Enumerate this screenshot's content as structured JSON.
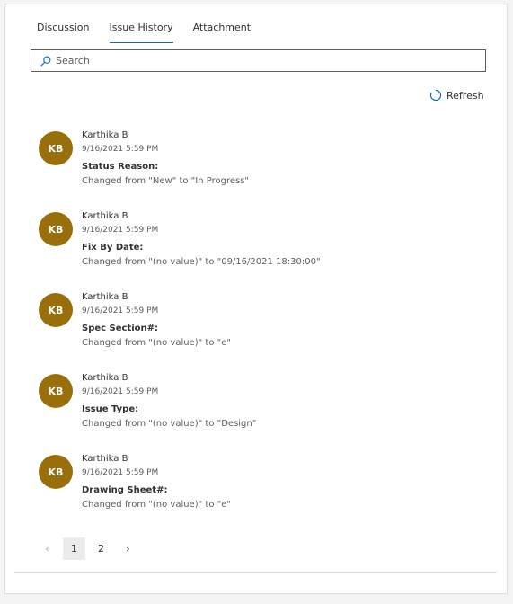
{
  "tabs": [
    {
      "label": "Discussion",
      "active": false
    },
    {
      "label": "Issue History",
      "active": true
    },
    {
      "label": "Attachment",
      "active": false
    }
  ],
  "search": {
    "placeholder": "Search",
    "icon": "search-icon"
  },
  "refresh": {
    "label": "Refresh",
    "icon": "refresh-icon"
  },
  "avatar_color": "#986f0b",
  "accent_color": "#0f6cbd",
  "entries": [
    {
      "initials": "KB",
      "name": "Karthika B",
      "time": "9/16/2021 5:59 PM",
      "field": "Status Reason:",
      "change": "Changed from \"New\" to \"In Progress\""
    },
    {
      "initials": "KB",
      "name": "Karthika B",
      "time": "9/16/2021 5:59 PM",
      "field": "Fix By Date:",
      "change": "Changed from \"(no value)\" to \"09/16/2021 18:30:00\""
    },
    {
      "initials": "KB",
      "name": "Karthika B",
      "time": "9/16/2021 5:59 PM",
      "field": "Spec Section#:",
      "change": "Changed from \"(no value)\" to \"e\""
    },
    {
      "initials": "KB",
      "name": "Karthika B",
      "time": "9/16/2021 5:59 PM",
      "field": "Issue Type:",
      "change": "Changed from \"(no value)\" to \"Design\""
    },
    {
      "initials": "KB",
      "name": "Karthika B",
      "time": "9/16/2021 5:59 PM",
      "field": "Drawing Sheet#:",
      "change": "Changed from \"(no value)\" to \"e\""
    }
  ],
  "pagination": {
    "prev": "‹",
    "pages": [
      "1",
      "2"
    ],
    "current": "1",
    "next": "›"
  }
}
